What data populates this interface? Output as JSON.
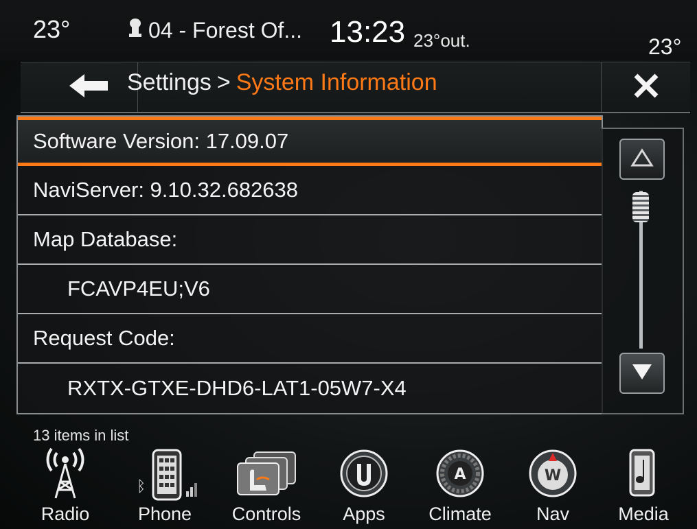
{
  "status_bar": {
    "temp_left": "23°",
    "station_icon": "bluetooth-audio-icon",
    "station": "04 - Forest Of...",
    "clock": "13:23",
    "outside_temp": "23°out.",
    "temp_right": "23°"
  },
  "header": {
    "back_icon": "back-arrow-icon",
    "breadcrumb_root": "Settings",
    "breadcrumb_separator": ">",
    "breadcrumb_current": "System Information",
    "close_icon": "close-icon",
    "accent_color": "#ff7a16"
  },
  "list": {
    "rows": [
      {
        "text": "Software Version: 17.09.07",
        "kind": "label",
        "selected": true
      },
      {
        "text": "NaviServer: 9.10.32.682638",
        "kind": "label",
        "selected": false
      },
      {
        "text": "Map Database:",
        "kind": "label",
        "selected": false
      },
      {
        "text": "FCAVP4EU;V6",
        "kind": "value",
        "selected": false
      },
      {
        "text": "Request Code:",
        "kind": "label",
        "selected": false
      },
      {
        "text": "RXTX-GTXE-DHD6-LAT1-05W7-X4",
        "kind": "value",
        "selected": false
      }
    ],
    "count_text": "13 items in list"
  },
  "scrollbar": {
    "up_icon": "scroll-up-icon",
    "down_icon": "scroll-down-icon"
  },
  "nav": {
    "items": [
      {
        "label": "Radio",
        "icon": "radio-tower-icon"
      },
      {
        "label": "Phone",
        "icon": "phone-icon"
      },
      {
        "label": "Controls",
        "icon": "controls-icon"
      },
      {
        "label": "Apps",
        "icon": "apps-icon"
      },
      {
        "label": "Climate",
        "icon": "climate-icon"
      },
      {
        "label": "Nav",
        "icon": "compass-icon"
      },
      {
        "label": "Media",
        "icon": "media-icon"
      }
    ]
  }
}
